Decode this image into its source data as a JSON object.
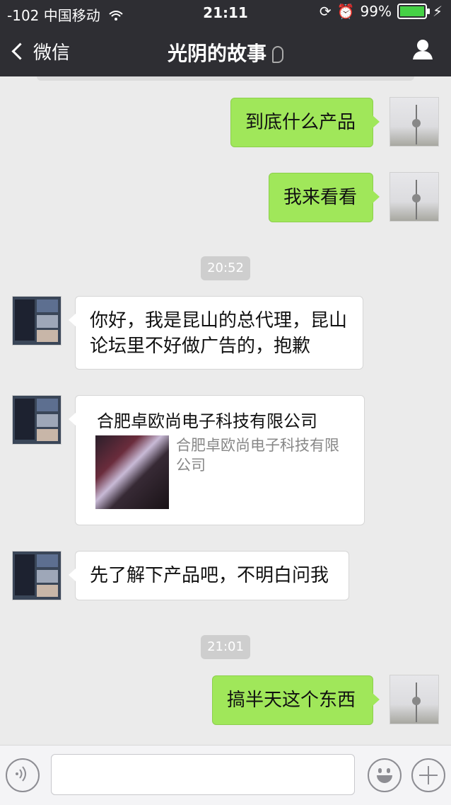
{
  "status": {
    "signal": "-102",
    "carrier": "中国移动",
    "time": "21:11",
    "battery_pct": "99%",
    "battery_level": 0.99
  },
  "nav": {
    "back_label": "微信",
    "title": "光阴的故事"
  },
  "messages": [
    {
      "text": "到底什么产品"
    },
    {
      "text": "我来看看"
    },
    {
      "text": "20:52"
    },
    {
      "text": "你好，我是昆山的总代理，昆山论坛里不好做广告的，抱歉"
    },
    {
      "card_title": "合肥卓欧尚电子科技有限公司",
      "card_desc": "合肥卓欧尚电子科技有限公司"
    },
    {
      "text": "先了解下产品吧，不明白问我"
    },
    {
      "text": "21:01"
    },
    {
      "text": "搞半天这个东西"
    }
  ],
  "colors": {
    "self_bubble": "#a0e75a",
    "header_bg": "#2e2e33",
    "chat_bg": "#ebebeb"
  },
  "icons": [
    "back-chevron-icon",
    "wifi-icon",
    "battery-icon",
    "ear-icon",
    "user-icon",
    "voice-icon",
    "emoji-icon",
    "plus-icon"
  ]
}
